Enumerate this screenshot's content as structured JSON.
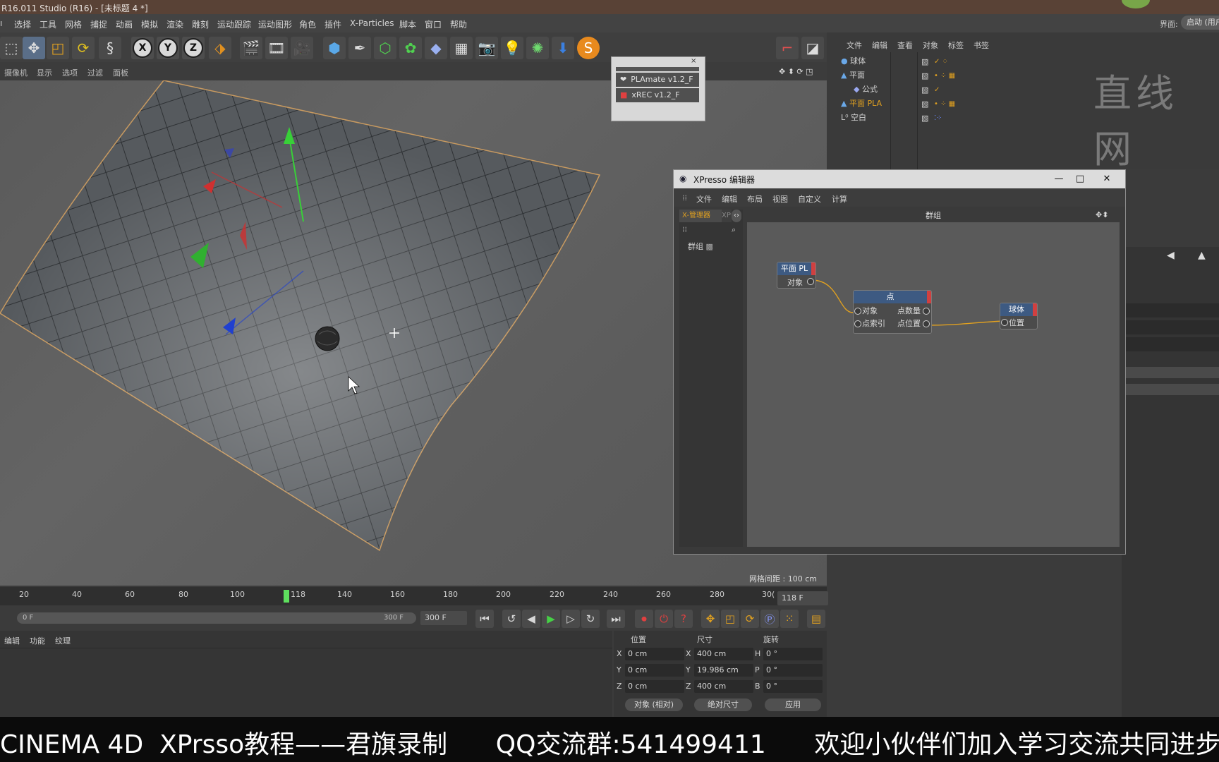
{
  "window": {
    "title": "R16.011 Studio (R16) - [未标题 4 *]"
  },
  "menubar": {
    "items": [
      "选择",
      "工具",
      "网格",
      "捕捉",
      "动画",
      "模拟",
      "渲染",
      "雕刻",
      "运动跟踪",
      "运动图形",
      "角色",
      "插件",
      "X-Particles",
      "脚本",
      "窗口",
      "帮助"
    ],
    "right_label": "界面:",
    "layout_value": "启动 (用户"
  },
  "viewport": {
    "menu": [
      "摄像机",
      "显示",
      "选项",
      "过滤",
      "面板"
    ],
    "grid_spacing": "网格间距 : 100 cm"
  },
  "timeline": {
    "ticks": [
      "20",
      "40",
      "60",
      "80",
      "100",
      "118",
      "140",
      "160",
      "180",
      "200",
      "220",
      "240",
      "260",
      "280",
      "30("
    ],
    "current_frame": "118 F",
    "range_start": "0 F",
    "range_end": "300 F",
    "range_end_field": "300 F"
  },
  "material_panel": {
    "tabs": [
      "编辑",
      "功能",
      "纹理"
    ]
  },
  "coords": {
    "headers": [
      "位置",
      "尺寸",
      "旋转"
    ],
    "rows": [
      {
        "axis": "X",
        "pos": "0 cm",
        "size_axis": "X",
        "size": "400 cm",
        "rot_axis": "H",
        "rot": "0 °"
      },
      {
        "axis": "Y",
        "pos": "0 cm",
        "size_axis": "Y",
        "size": "19.986 cm",
        "rot_axis": "P",
        "rot": "0 °"
      },
      {
        "axis": "Z",
        "pos": "0 cm",
        "size_axis": "Z",
        "size": "400 cm",
        "rot_axis": "B",
        "rot": "0 °"
      }
    ],
    "mode_select": "对象 (相对)",
    "size_select": "绝对尺寸",
    "apply_label": "应用"
  },
  "object_manager": {
    "menu": [
      "文件",
      "编辑",
      "查看",
      "对象",
      "标签",
      "书签"
    ],
    "objects": [
      "球体",
      "平面",
      "公式",
      "平面 PLA",
      "空白"
    ],
    "watermark": "直线网"
  },
  "plugin_popup": {
    "items": [
      "PLAmate v1.2_F",
      "xREC v1.2_F"
    ]
  },
  "xpresso": {
    "title": "XPresso 编辑器",
    "menu": [
      "文件",
      "编辑",
      "布局",
      "视图",
      "自定义",
      "计算"
    ],
    "manager_tab": "X-管理器",
    "manager_tab2": "XP",
    "tree_item": "群组",
    "canvas_title": "群组",
    "node_plane": {
      "title": "平面 PL",
      "port": "对象"
    },
    "node_point": {
      "title": "点",
      "in1": "对象",
      "in2": "点索引",
      "out1": "点数量",
      "out2": "点位置"
    },
    "node_sphere": {
      "title": "球体",
      "port": "位置"
    }
  },
  "banner": {
    "text": "CINEMA 4D  XPrsso教程——君旗录制      QQ交流群:541499411      欢迎小伙伴们加入学习交流共同进步"
  }
}
